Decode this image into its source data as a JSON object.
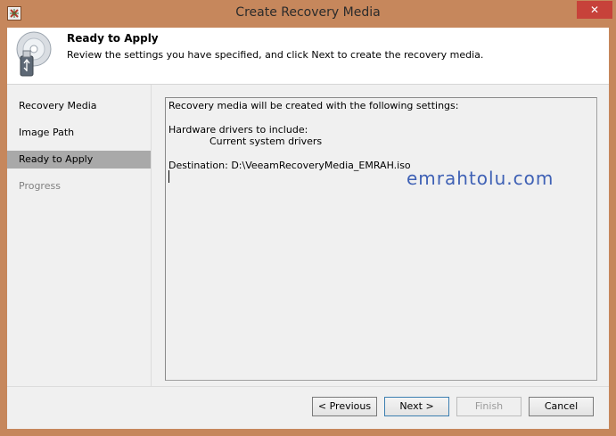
{
  "window": {
    "title": "Create Recovery Media",
    "close_glyph": "✕"
  },
  "header": {
    "title": "Ready to Apply",
    "description": "Review the settings you have specified, and click Next to create the recovery media.",
    "icon": "recovery-media-icon"
  },
  "nav": {
    "items": [
      {
        "label": "Recovery Media",
        "state": "normal"
      },
      {
        "label": "Image Path",
        "state": "normal"
      },
      {
        "label": "Ready to Apply",
        "state": "selected"
      },
      {
        "label": "Progress",
        "state": "disabled"
      }
    ]
  },
  "summary": {
    "line1": "Recovery media will be created with the following settings:",
    "line2": "Hardware drivers to include:",
    "line3": "Current system drivers",
    "line4": "Destination: D:\\VeeamRecoveryMedia_EMRAH.iso"
  },
  "watermark": "emrahtolu.com",
  "buttons": {
    "previous": "< Previous",
    "next": "Next >",
    "finish": "Finish",
    "cancel": "Cancel"
  },
  "colors": {
    "frame": "#c6875c",
    "close": "#c7423a",
    "selected_nav": "#a9a9a9",
    "watermark": "#3f61b5"
  }
}
